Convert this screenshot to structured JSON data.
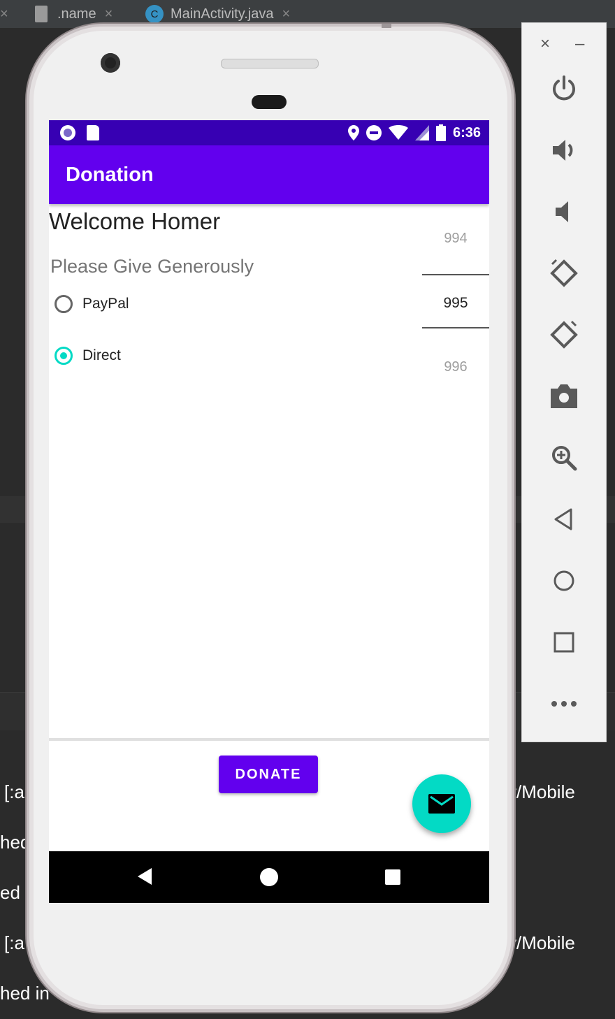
{
  "ide": {
    "tabs": [
      {
        "label": ".name",
        "icon": "file-icon"
      },
      {
        "label": "MainActivity.java",
        "icon": "java-class-icon",
        "icon_text": "C"
      }
    ],
    "tab_close": "×",
    "console_lines": [
      {
        "left": "[:a",
        "right": "y/Mobile"
      },
      {
        "left": "hed",
        "right": ""
      },
      {
        "left": "ed",
        "right": ""
      },
      {
        "left": "[:a",
        "right": "y/Mobile"
      },
      {
        "left": "hed in",
        "right": ""
      }
    ]
  },
  "status_bar": {
    "time": "6:36",
    "icons": [
      "notification-icon",
      "sd-card-icon",
      "location-icon",
      "do-not-disturb-icon",
      "wifi-icon",
      "signal-icon",
      "battery-icon"
    ]
  },
  "app_bar": {
    "title": "Donation"
  },
  "content": {
    "welcome": "Welcome Homer",
    "subtitle": "Please Give Generously",
    "payment_options": [
      {
        "label": "PayPal",
        "checked": false
      },
      {
        "label": "Direct",
        "checked": true
      }
    ],
    "amount_picker": {
      "above": "994",
      "current": "995",
      "below": "996"
    }
  },
  "donate_button": "DONATE",
  "fab_icon": "mail-icon",
  "colors": {
    "primary": "#6200ee",
    "primary_dark": "#3700b3",
    "accent": "#03dac5"
  },
  "emulator_controls": {
    "close": "×",
    "minimize": "–",
    "buttons": [
      "power-icon",
      "volume-up-icon",
      "volume-down-icon",
      "rotate-left-icon",
      "rotate-right-icon",
      "camera-icon",
      "zoom-icon",
      "back-icon",
      "home-icon",
      "overview-icon",
      "more-icon"
    ]
  }
}
